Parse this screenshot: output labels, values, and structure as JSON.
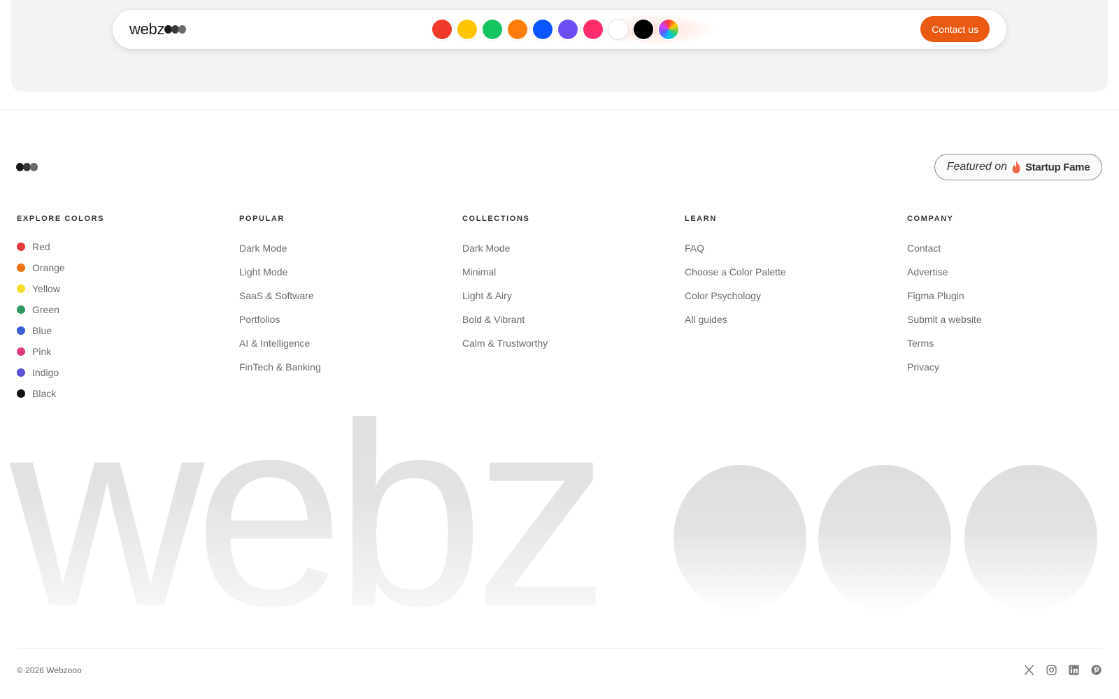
{
  "header": {
    "logo_text": "webz",
    "logo_dot_colors": [
      "#1a1a1a",
      "#3a3a3a",
      "#6a6a6a"
    ],
    "swatches": [
      {
        "name": "red",
        "color": "#f23a2c"
      },
      {
        "name": "yellow",
        "color": "#ffc400"
      },
      {
        "name": "green",
        "color": "#14c45e"
      },
      {
        "name": "orange",
        "color": "#ff7d0a"
      },
      {
        "name": "blue",
        "color": "#0a55ff"
      },
      {
        "name": "purple",
        "color": "#6c4cf5"
      },
      {
        "name": "pink",
        "color": "#ff2d6b"
      },
      {
        "name": "white",
        "color": "#ffffff"
      },
      {
        "name": "black",
        "color": "#000000"
      },
      {
        "name": "rainbow",
        "color": "conic"
      }
    ],
    "contact_label": "Contact us",
    "accent_color": "#ea5a12"
  },
  "featured": {
    "prefix": "Featured on",
    "brand": "Startup Fame",
    "flame_color": "#f06a4a"
  },
  "footer": {
    "explore": {
      "title": "EXPLORE COLORS",
      "items": [
        {
          "label": "Red",
          "color": "#e23c3c"
        },
        {
          "label": "Orange",
          "color": "#f27318"
        },
        {
          "label": "Yellow",
          "color": "#f5dc2a"
        },
        {
          "label": "Green",
          "color": "#2e9a62"
        },
        {
          "label": "Blue",
          "color": "#3c5ed6"
        },
        {
          "label": "Pink",
          "color": "#e03a82"
        },
        {
          "label": "Indigo",
          "color": "#5a4fd0"
        },
        {
          "label": "Black",
          "color": "#111111"
        }
      ]
    },
    "popular": {
      "title": "POPULAR",
      "items": [
        "Dark Mode",
        "Light Mode",
        "SaaS & Software",
        "Portfolios",
        "AI & Intelligence",
        "FinTech & Banking"
      ]
    },
    "collections": {
      "title": "COLLECTIONS",
      "items": [
        "Dark Mode",
        "Minimal",
        "Light & Airy",
        "Bold & Vibrant",
        "Calm & Trustworthy"
      ]
    },
    "learn": {
      "title": "LEARN",
      "items": [
        "FAQ",
        "Choose a Color Palette",
        "Color Psychology",
        "All guides"
      ]
    },
    "company": {
      "title": "COMPANY",
      "items": [
        "Contact",
        "Advertise",
        "Figma Plugin",
        "Submit a website",
        "Terms",
        "Privacy"
      ]
    },
    "wordmark": "webz",
    "copyright": "© 2026 Webzooo",
    "socials": [
      "x-icon",
      "instagram-icon",
      "linkedin-icon",
      "pinterest-icon"
    ]
  }
}
